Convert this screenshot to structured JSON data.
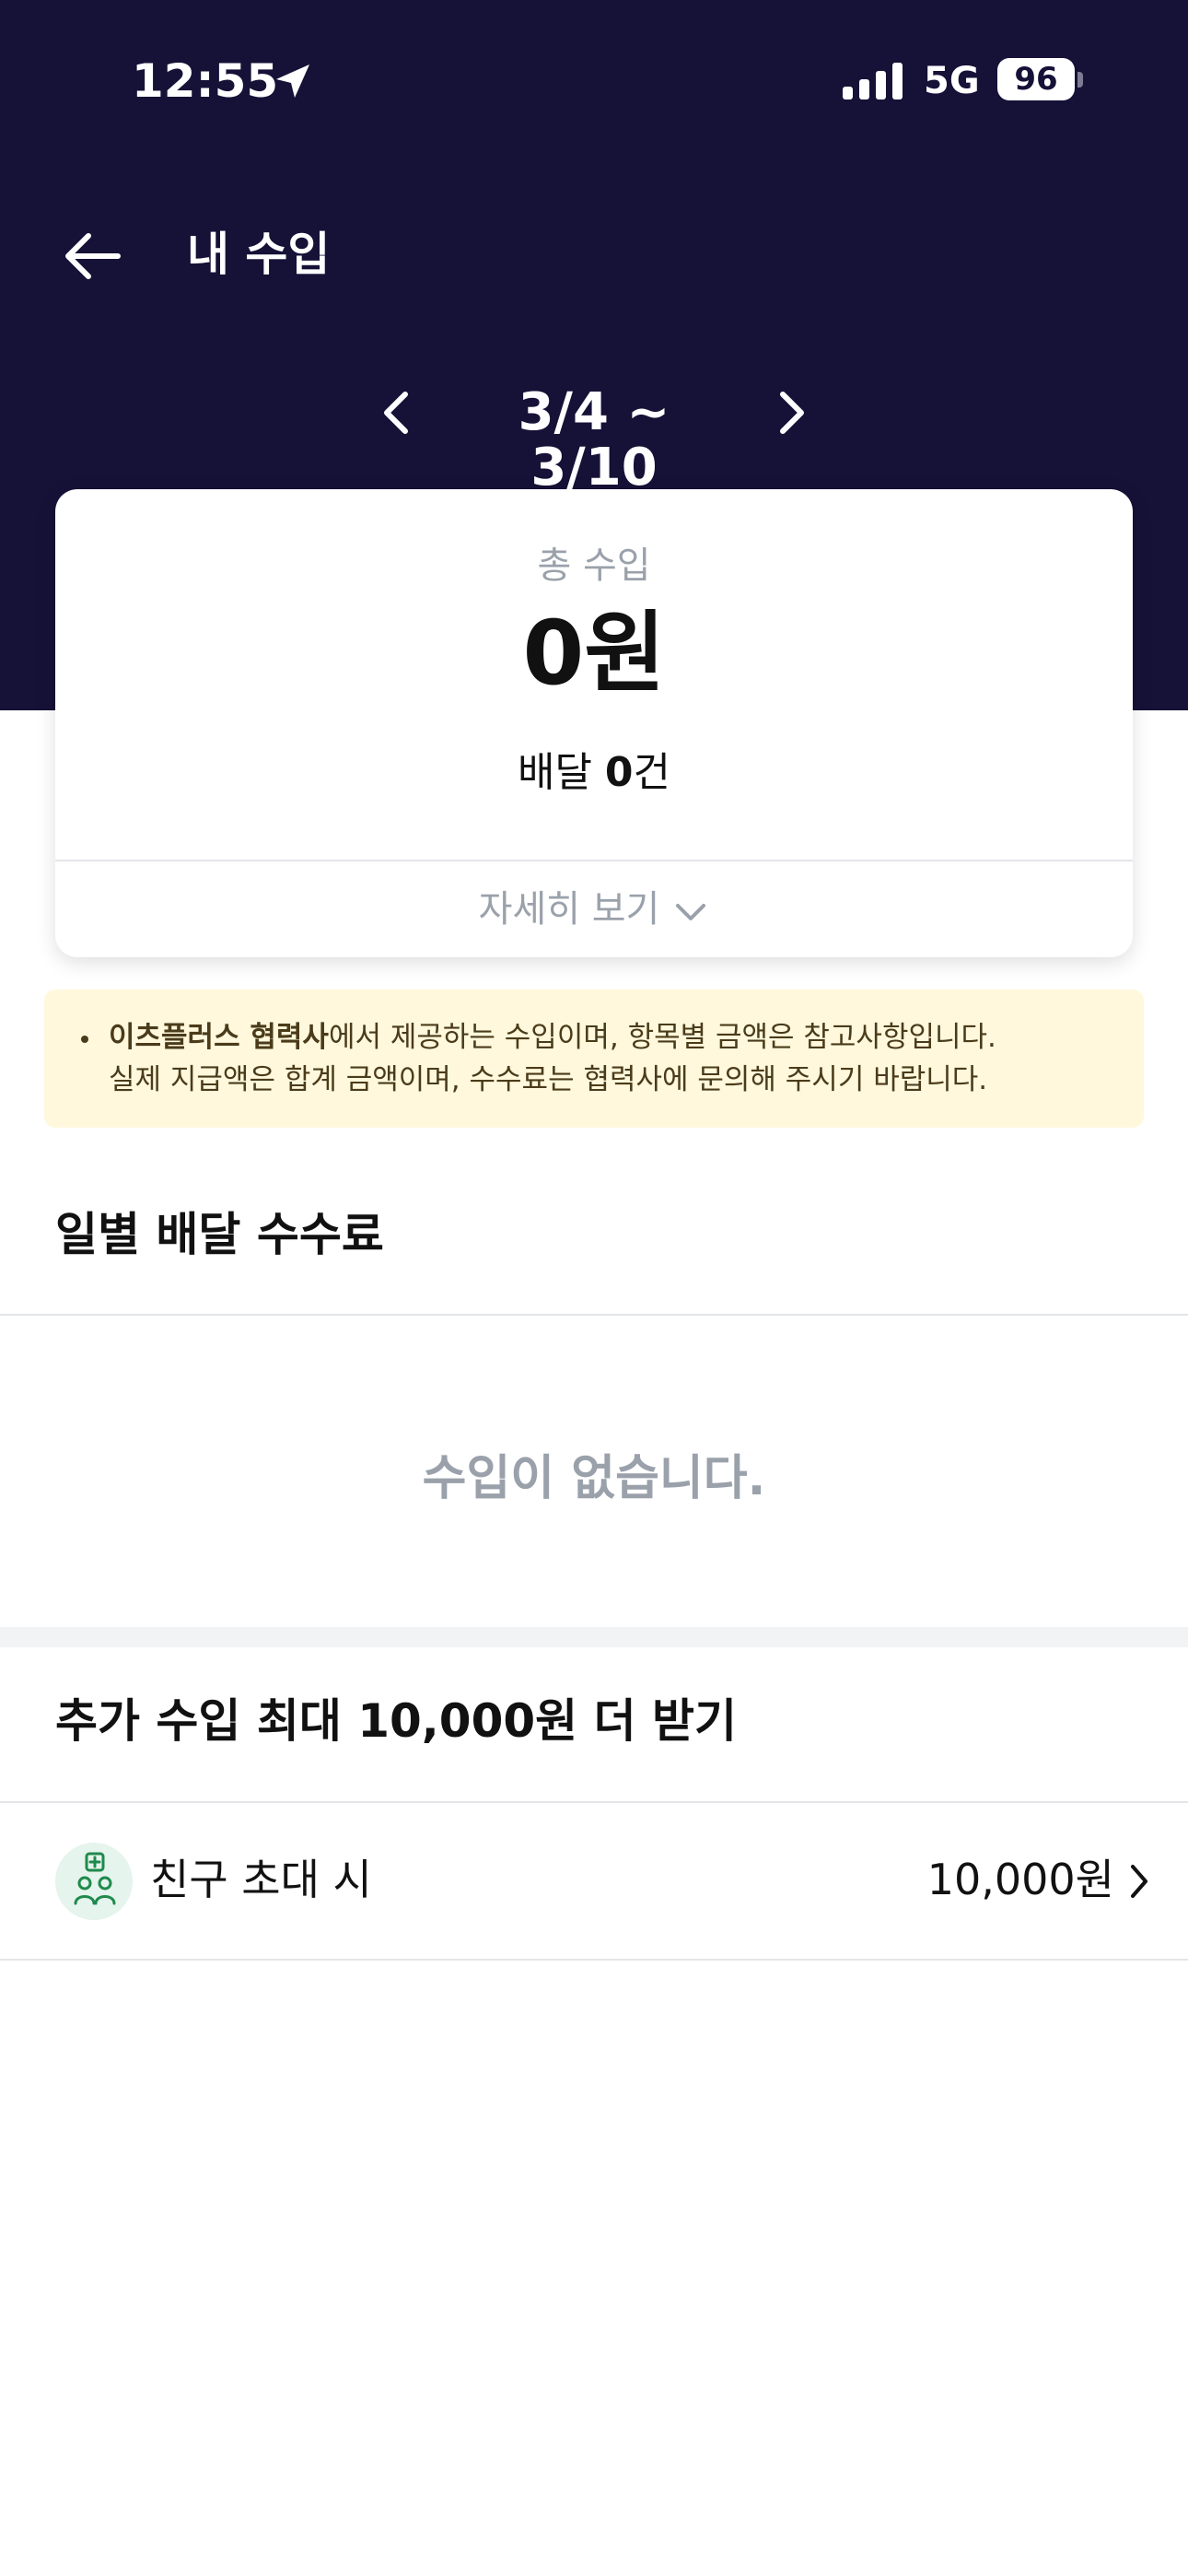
{
  "status_bar": {
    "time": "12:55",
    "network": "5G",
    "battery": "96"
  },
  "header": {
    "title": "내 수입",
    "range": "3/4 ~ 3/10",
    "background_color": "#161137"
  },
  "summary": {
    "total_label": "총 수입",
    "total_value": "0원",
    "delivery_prefix": "배달 ",
    "delivery_count": "0",
    "delivery_suffix": "건",
    "details_label": "자세히 보기"
  },
  "notice": {
    "line1_bold": "이츠플러스 협력사",
    "line1_rest": "에서 제공하는 수입이며, 항목별 금액은 참고사항입니다.",
    "line2": "실제 지급액은 합계 금액이며, 수수료는 협력사에 문의해 주시기 바랍니다.",
    "background_color": "#fff8dc"
  },
  "daily_fees": {
    "title": "일별 배달 수수료",
    "empty_message": "수입이 없습니다."
  },
  "bonus": {
    "title": "추가 수입 최대 10,000원 더 받기",
    "items": [
      {
        "label": "친구 초대 시",
        "amount": "10,000원",
        "icon": "friends-plus-icon"
      }
    ]
  }
}
